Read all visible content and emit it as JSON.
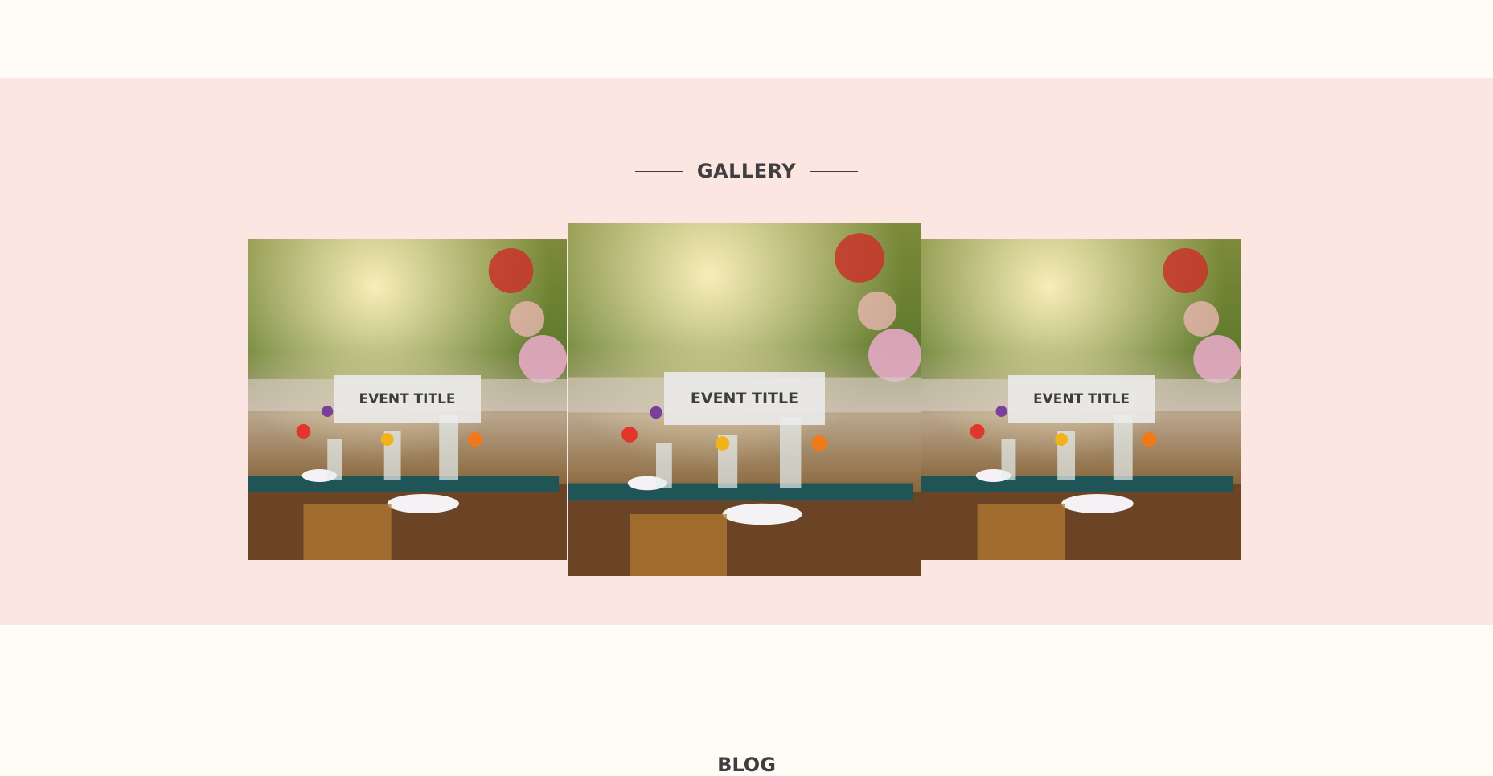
{
  "gallery": {
    "heading": "GALLERY",
    "cards": [
      {
        "title": "EVENT TITLE",
        "image": "outdoor-wedding-table-photo"
      },
      {
        "title": "EVENT TITLE",
        "image": "outdoor-wedding-table-photo"
      },
      {
        "title": "EVENT TITLE",
        "image": "outdoor-wedding-table-photo"
      }
    ]
  },
  "blog": {
    "heading": "BLOG"
  },
  "colors": {
    "page_background": "#fffcf5",
    "gallery_background": "#fbe6e1",
    "heading_text": "#3f3f3f",
    "label_background": "#ececec"
  }
}
